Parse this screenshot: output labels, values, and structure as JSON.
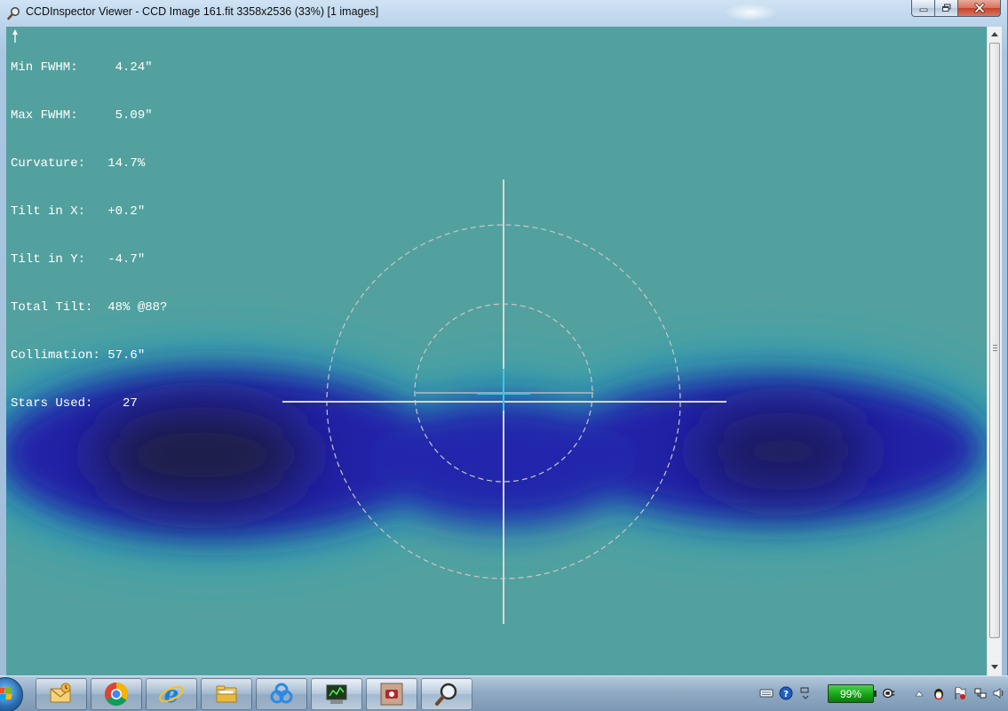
{
  "window": {
    "title": "CCDInspector Viewer - CCD Image 161.fit 3358x2536 (33%)  [1 images]",
    "app_icon": "ccdinspector-magnifier-icon",
    "controls": {
      "minimize_icon": "minimize-icon",
      "maximize_icon": "maximize-icon",
      "close_icon": "close-icon"
    }
  },
  "stats": [
    {
      "label": "Min FWHM:",
      "value": "     4.24\""
    },
    {
      "label": "Max FWHM:",
      "value": "     5.09\""
    },
    {
      "label": "Curvature:",
      "value": "   14.7%"
    },
    {
      "label": "Tilt in X:",
      "value": "   +0.2\""
    },
    {
      "label": "Tilt in Y:",
      "value": "   -4.7\""
    },
    {
      "label": "Total Tilt:",
      "value": "  48% @88?"
    },
    {
      "label": "Collimation:",
      "value": " 57.6\""
    },
    {
      "label": "Stars Used:",
      "value": "    27"
    }
  ],
  "tilt_arrow_icon": "tilt-direction-arrow-icon",
  "colors": {
    "background": "#53a19f",
    "map_deep": "#1a1a40",
    "map_mid": "#2020a0",
    "map_edge": "#2a9aa8",
    "overlay_lines": "#d8d8d8",
    "stats_text": "#ffffff"
  },
  "scrollbar": {
    "up_icon": "scroll-up-arrow-icon",
    "down_icon": "scroll-down-arrow-icon"
  },
  "taskbar": {
    "start_icon": "windows-start-orb-icon",
    "apps": [
      {
        "name": "outlook-mail-icon",
        "active": false
      },
      {
        "name": "chrome-icon",
        "active": false
      },
      {
        "name": "internet-explorer-icon",
        "active": false
      },
      {
        "name": "file-explorer-icon",
        "active": false
      },
      {
        "name": "baidu-cloud-icon",
        "active": false
      },
      {
        "name": "maxim-dl-icon",
        "active": true
      },
      {
        "name": "camera-app-icon",
        "active": true
      },
      {
        "name": "ccdinspector-icon",
        "active": true
      }
    ],
    "tray": {
      "keyboard_icon": "keyboard-icon",
      "help_icon": "help-icon",
      "ime_icon": "ime-icon",
      "battery_label": "99%",
      "power_icon": "power-plug-icon",
      "show_hidden_icon": "show-hidden-icons-arrow",
      "qq_icon": "qq-penguin-icon",
      "action_center_icon": "action-center-flag-icon",
      "network_icon": "network-icon",
      "volume_icon": "volume-icon"
    }
  }
}
